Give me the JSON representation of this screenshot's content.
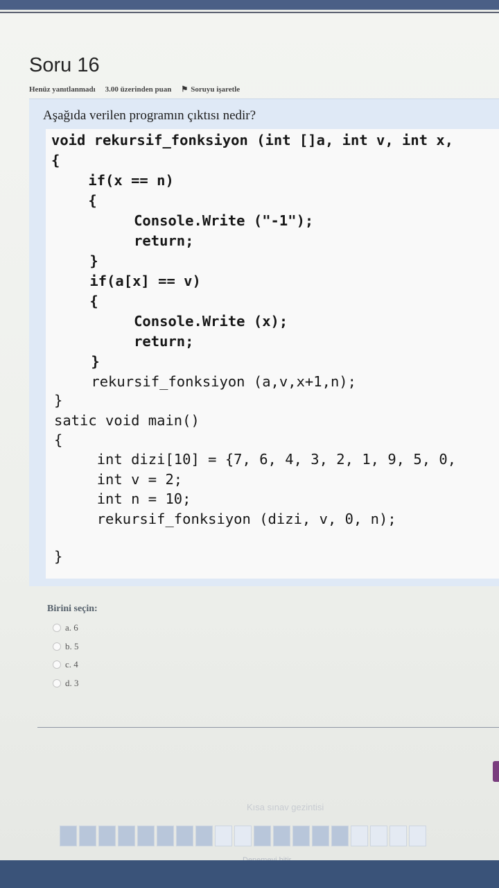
{
  "question": {
    "title": "Soru 16",
    "status": "Henüz yanıtlanmadı",
    "points": "3.00 üzerinden puan",
    "flag_label": "Soruyu işaretle",
    "prompt": "Aşağıda verilen programın çıktısı nedir?"
  },
  "code": [
    "void rekursif_fonksiyon (int []a, int v, int x,",
    "{",
    "    if(x == n)",
    "    {",
    "         Console.Write (\"-1\");",
    "         return;",
    "    }",
    "    if(a[x] == v)",
    "    {",
    "         Console.Write (x);",
    "         return;",
    "    }",
    "    rekursif_fonksiyon (a,v,x+1,n);",
    "}",
    "satic void main()",
    "{",
    "     int dizi[10] = {7, 6, 4, 3, 2, 1, 9, 5, 0,",
    "     int v = 2;",
    "     int n = 10;",
    "     rekursif_fonksiyon (dizi, v, 0, n);",
    "}"
  ],
  "answers": {
    "label": "Birini seçin:",
    "options": [
      "a. 6",
      "b. 5",
      "c. 4",
      "d. 3"
    ]
  },
  "navigation": {
    "title": "Kısa sınav gezintisi",
    "finish": "Denemeyi bitir..."
  },
  "colors": {
    "panel": "#dfe9f6",
    "code_bg": "#f9f9f9",
    "accent": "#7a3d7e",
    "header_bar": "#4a5f86"
  }
}
